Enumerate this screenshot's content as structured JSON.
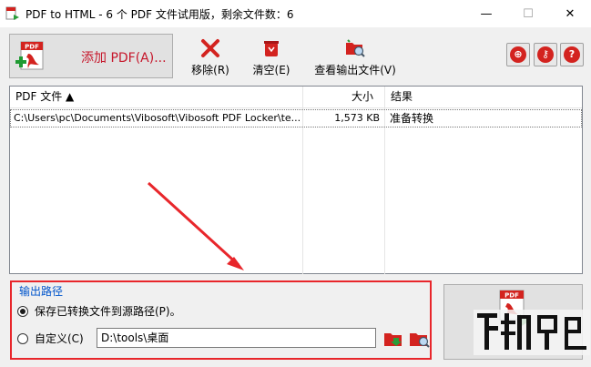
{
  "window": {
    "title": "PDF to HTML - 6 个 PDF 文件试用版，剩余文件数：6",
    "minimize_glyph": "—",
    "maximize_glyph": "☐",
    "close_glyph": "✕"
  },
  "toolbar": {
    "add_pdf_label": "添加 PDF(A)...",
    "remove_label": "移除(R)",
    "clear_label": "清空(E)",
    "view_output_label": "查看输出文件(V)",
    "pdf_badge": "PDF",
    "right_icons": [
      "globe-icon",
      "key-icon",
      "help-icon"
    ]
  },
  "file_list": {
    "columns": [
      "PDF 文件 ▲",
      "大小",
      "结果"
    ],
    "rows": [
      {
        "file": "C:\\Users\\pc\\Documents\\Vibosoft\\Vibosoft PDF Locker\\te...",
        "size": "1,573 KB",
        "result": "准备转换"
      }
    ]
  },
  "output": {
    "group_title": "输出路径",
    "option_source_label": "保存已转换文件到源路径(P)。",
    "option_custom_label": "自定义(C)",
    "custom_path_value": "D:\\tools\\桌面",
    "selected": "source"
  },
  "convert": {
    "pdf_badge": "PDF"
  },
  "colors": {
    "accent_red": "#e8262b",
    "group_title_blue": "#0055cc"
  }
}
